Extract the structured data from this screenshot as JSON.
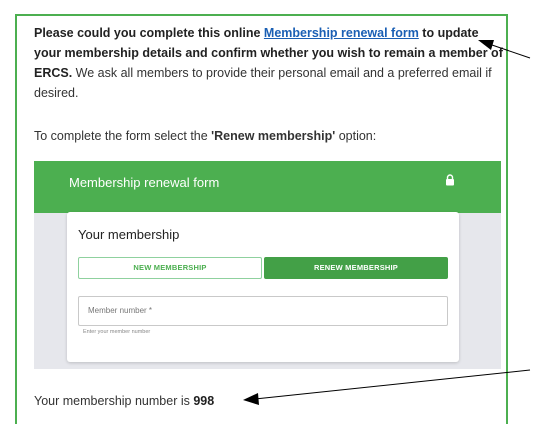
{
  "intro": {
    "lead_bold": "Please could you complete this online ",
    "link_text": "Membership renewal form",
    "tail_bold": " to update your membership details and confirm whether you wish to remain a member of ERCS.",
    "rest": " We ask all members to provide their personal email and a preferred email if desired."
  },
  "instruction": {
    "prefix": "To complete the form select the ",
    "option": "'Renew membership'",
    "suffix": " option:"
  },
  "form": {
    "header_title": "Membership renewal form",
    "card_title": "Your membership",
    "new_button": "NEW MEMBERSHIP",
    "renew_button": "RENEW MEMBERSHIP",
    "member_placeholder": "Member number *",
    "member_helper": "Enter your member number"
  },
  "result": {
    "prefix": "Your membership number is ",
    "number": "998"
  },
  "colors": {
    "accent": "#4caf50",
    "link": "#1a5fb4",
    "panel_bg": "#e6e7ec"
  },
  "icons": {
    "header_icon": "lock-icon",
    "annotations": "arrow-icon"
  }
}
